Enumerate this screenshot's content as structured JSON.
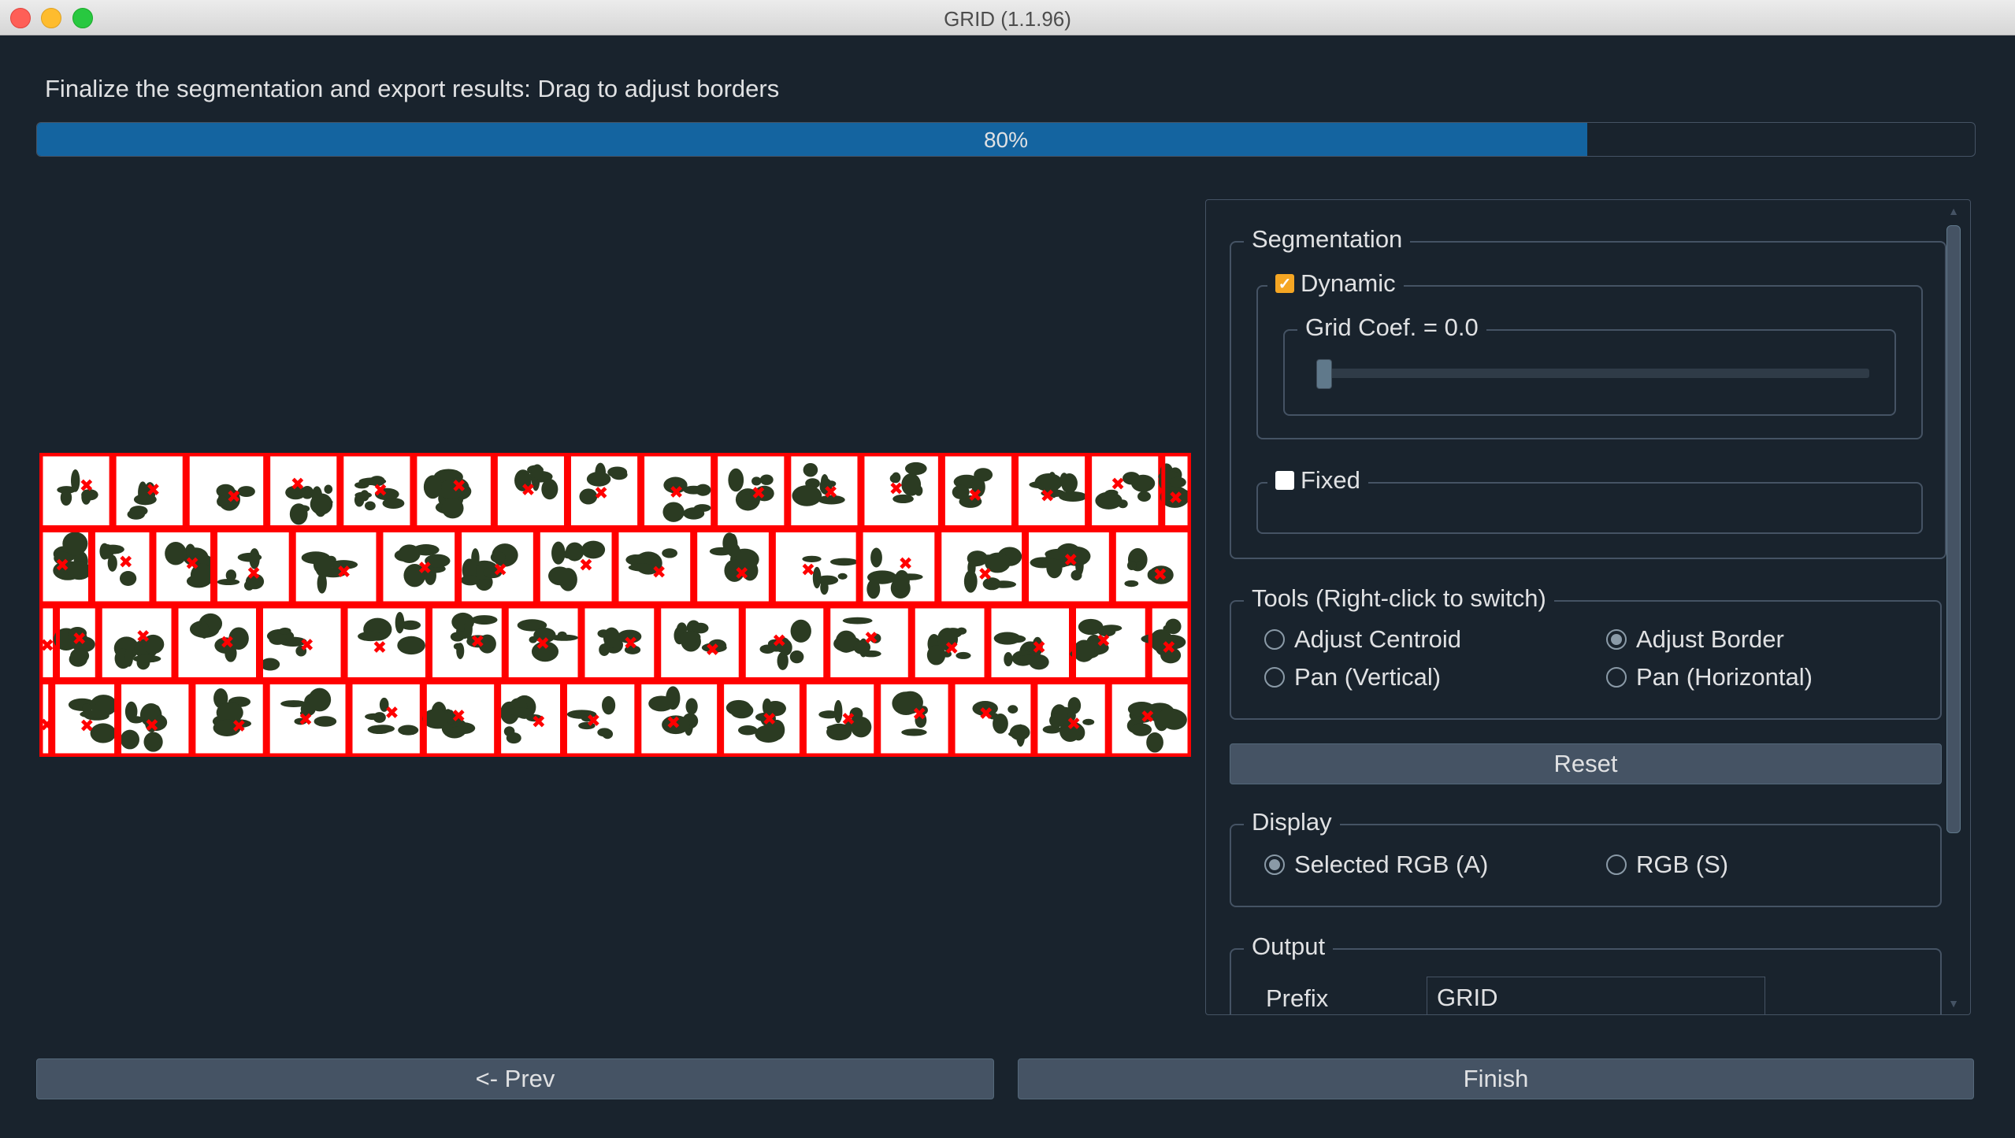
{
  "window": {
    "title": "GRID (1.1.96)"
  },
  "instruction": "Finalize the segmentation and export results: Drag to adjust borders",
  "progress": {
    "value": 0.8,
    "label": "80%"
  },
  "colors": {
    "background": "#19232d",
    "accent": "#1464a0",
    "grid_border": "#ff0000",
    "centroid": "#ff0000",
    "plant": "#2b3b22"
  },
  "plot": {
    "rows": [
      {
        "cells": 16,
        "widths": [
          1.0,
          1.0,
          1.1,
          1.0,
          1.0,
          1.1,
          1.0,
          1.0,
          1.0,
          1.0,
          1.0,
          1.1,
          1.0,
          1.0,
          1.0,
          0.4
        ]
      },
      {
        "cells": 15,
        "widths": [
          0.6,
          0.7,
          0.7,
          0.9,
          1.0,
          0.9,
          0.9,
          0.9,
          0.9,
          0.9,
          1.0,
          0.9,
          1.0,
          1.0,
          0.9
        ]
      },
      {
        "cells": 16,
        "widths": [
          0.2,
          0.5,
          0.9,
          1.0,
          1.0,
          1.0,
          0.9,
          0.9,
          0.9,
          1.0,
          1.0,
          1.0,
          0.9,
          1.0,
          0.9,
          0.5
        ]
      },
      {
        "cells": 16,
        "widths": [
          0.15,
          0.8,
          0.9,
          0.9,
          1.0,
          0.9,
          0.9,
          0.8,
          0.9,
          1.0,
          1.0,
          0.9,
          0.9,
          1.0,
          0.9,
          1.0
        ]
      }
    ]
  },
  "panel": {
    "segmentation": {
      "title": "Segmentation",
      "dynamic": {
        "label": "Dynamic",
        "checked": true
      },
      "grid_coef": {
        "label": "Grid Coef. = 0.0",
        "value": 0.0
      },
      "fixed": {
        "label": "Fixed",
        "checked": false
      }
    },
    "tools": {
      "title": "Tools (Right-click to switch)",
      "options": [
        {
          "label": "Adjust Centroid",
          "selected": false
        },
        {
          "label": "Adjust Border",
          "selected": true
        },
        {
          "label": "Pan (Vertical)",
          "selected": false
        },
        {
          "label": "Pan (Horizontal)",
          "selected": false
        }
      ]
    },
    "reset_label": "Reset",
    "display": {
      "title": "Display",
      "options": [
        {
          "label": "Selected RGB (A)",
          "selected": true
        },
        {
          "label": "RGB (S)",
          "selected": false
        }
      ]
    },
    "output": {
      "title": "Output",
      "prefix_label": "Prefix",
      "prefix_value": "GRID"
    }
  },
  "nav": {
    "prev_label": "<- Prev",
    "finish_label": "Finish"
  }
}
